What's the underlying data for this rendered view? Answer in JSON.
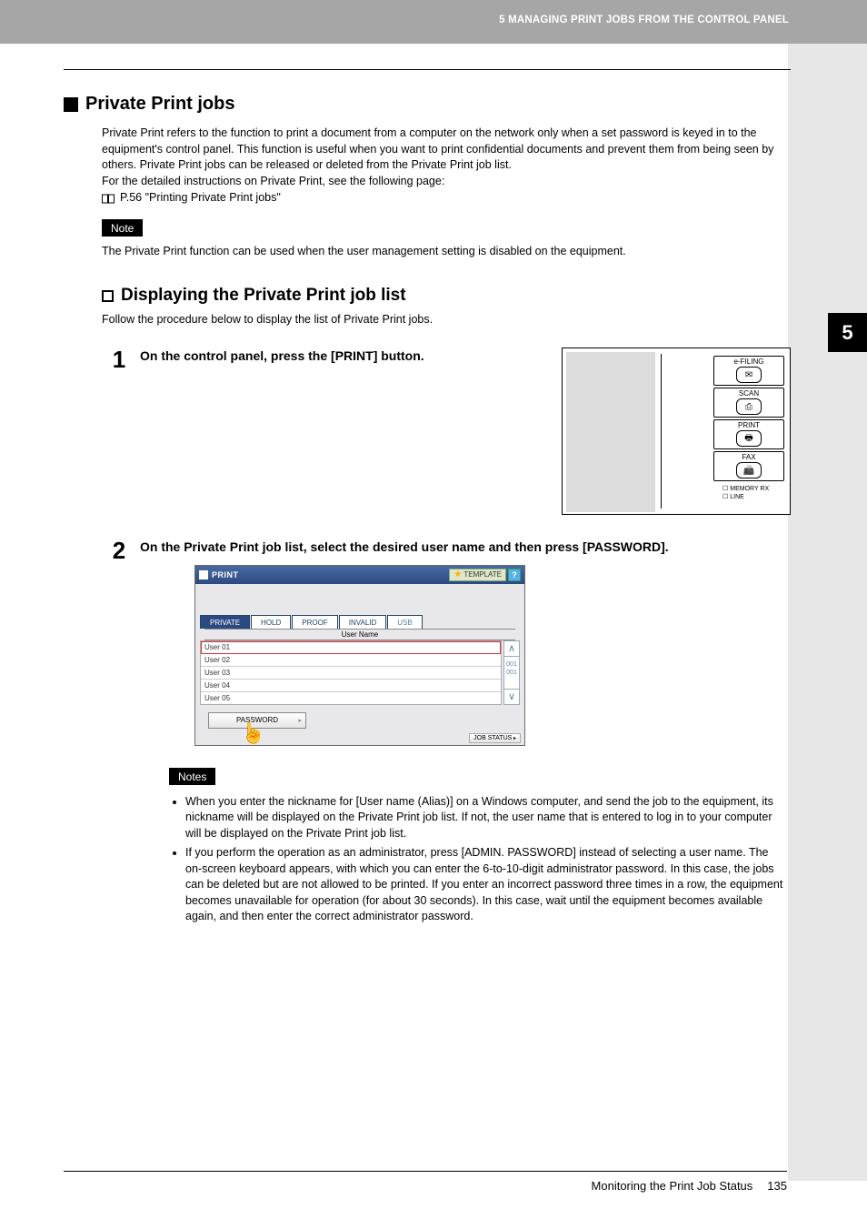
{
  "header": {
    "running_title": "5 MANAGING PRINT JOBS FROM THE CONTROL PANEL"
  },
  "side_tab": "5",
  "section": {
    "title": "Private Print jobs",
    "para": "Private Print refers to the function to print a document from a computer on the network only when a set password is keyed in to the equipment's control panel. This function is useful when you want to print confidential documents and prevent them from being seen by others. Private Print jobs can be released or deleted from the Private Print job list.",
    "para2": "For the detailed instructions on Private Print, see the following page:",
    "link": "P.56 \"Printing Private Print jobs\""
  },
  "note": {
    "label": "Note",
    "text": "The Private Print function can be used when the user management setting is disabled on the equipment."
  },
  "subsection": {
    "title": "Displaying the Private Print job list",
    "text": "Follow the procedure below to display the list of Private Print jobs."
  },
  "steps": [
    {
      "num": "1",
      "text": "On the control panel, press the [PRINT] button."
    },
    {
      "num": "2",
      "text": "On the Private Print job list, select the desired user name and then press [PASSWORD]."
    }
  ],
  "panel_buttons": {
    "efiling": "e-FILING",
    "scan": "SCAN",
    "print": "PRINT",
    "fax": "FAX",
    "memrx": "MEMORY RX",
    "line": "LINE"
  },
  "mock": {
    "title": "PRINT",
    "template_btn": "TEMPLATE",
    "help": "?",
    "tabs": [
      "PRIVATE",
      "HOLD",
      "PROOF",
      "INVALID",
      "USB"
    ],
    "col_header": "User Name",
    "users": [
      "User 01",
      "User 02",
      "User 03",
      "User 04",
      "User 05"
    ],
    "page_ind": "001\n001",
    "password_btn": "PASSWORD",
    "jobstatus": "JOB STATUS"
  },
  "notes2": {
    "label": "Notes",
    "items": [
      "When you enter the nickname for [User name (Alias)] on a Windows computer, and send the job to the equipment, its nickname will be displayed on the Private Print job list. If not, the user name that is entered to log in to your computer will be displayed on the Private Print job list.",
      "If you perform the operation as an administrator, press [ADMIN. PASSWORD] instead of selecting a user name. The on-screen keyboard appears, with which you can enter the 6-to-10-digit administrator password. In this case, the jobs can be deleted but are not allowed to be printed. If you enter an incorrect password three times in a row, the equipment becomes unavailable for operation (for about 30 seconds). In this case, wait until the equipment becomes available again, and then enter the correct administrator password."
    ]
  },
  "footer": {
    "text": "Monitoring the Print Job Status",
    "page": "135"
  }
}
